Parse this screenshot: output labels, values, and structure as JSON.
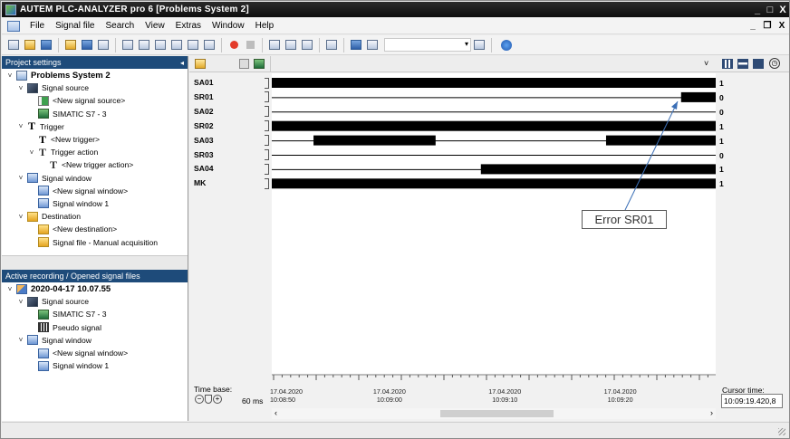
{
  "window": {
    "title": "AUTEM  PLC-ANALYZER pro 6 [Problems System 2]",
    "min": "_",
    "max": "□",
    "close": "X"
  },
  "menu": {
    "items": [
      "File",
      "Signal file",
      "Search",
      "View",
      "Extras",
      "Window",
      "Help"
    ],
    "mdi_min": "_",
    "mdi_restore": "❐",
    "mdi_close": "X"
  },
  "project_panel": {
    "title": "Project settings",
    "tree": [
      {
        "level": 0,
        "toggle": "˅",
        "icon": "project-icon",
        "label": "Problems System 2",
        "bold": true
      },
      {
        "level": 1,
        "toggle": "˅",
        "icon": "signal-source-icon",
        "label": "Signal source"
      },
      {
        "level": 2,
        "toggle": "",
        "icon": "new-source-icon",
        "label": "<New signal source>"
      },
      {
        "level": 2,
        "toggle": "",
        "icon": "plc-icon",
        "label": "SIMATIC S7 - 3"
      },
      {
        "level": 1,
        "toggle": "˅",
        "icon": "trigger-icon",
        "label": "Trigger"
      },
      {
        "level": 2,
        "toggle": "",
        "icon": "trigger-icon",
        "label": "<New trigger>"
      },
      {
        "level": 2,
        "toggle": "˅",
        "icon": "trigger-action-icon",
        "label": "Trigger action"
      },
      {
        "level": 3,
        "toggle": "",
        "icon": "trigger-action-icon",
        "label": "<New trigger action>"
      },
      {
        "level": 1,
        "toggle": "˅",
        "icon": "signal-window-icon",
        "label": "Signal window"
      },
      {
        "level": 2,
        "toggle": "",
        "icon": "signal-window-icon",
        "label": "<New signal window>"
      },
      {
        "level": 2,
        "toggle": "",
        "icon": "signal-window-icon",
        "label": "Signal window 1"
      },
      {
        "level": 1,
        "toggle": "˅",
        "icon": "destination-icon",
        "label": "Destination"
      },
      {
        "level": 2,
        "toggle": "",
        "icon": "destination-icon",
        "label": "<New destination>"
      },
      {
        "level": 2,
        "toggle": "",
        "icon": "destination-icon",
        "label": "Signal file - Manual acquisition"
      }
    ]
  },
  "recording_panel": {
    "title": "Active recording / Opened signal files",
    "tree": [
      {
        "level": 0,
        "toggle": "˅",
        "icon": "recording-icon",
        "label": "2020-04-17 10.07.55",
        "bold": true
      },
      {
        "level": 1,
        "toggle": "˅",
        "icon": "signal-source-icon",
        "label": "Signal source"
      },
      {
        "level": 2,
        "toggle": "",
        "icon": "plc-icon",
        "label": "SIMATIC S7 - 3"
      },
      {
        "level": 2,
        "toggle": "",
        "icon": "pseudo-signal-icon",
        "label": "Pseudo signal"
      },
      {
        "level": 1,
        "toggle": "˅",
        "icon": "signal-window-icon",
        "label": "Signal window"
      },
      {
        "level": 2,
        "toggle": "",
        "icon": "signal-window-icon",
        "label": "<New signal window>"
      },
      {
        "level": 2,
        "toggle": "",
        "icon": "signal-window-icon",
        "label": "Signal window 1"
      }
    ]
  },
  "signals": [
    {
      "name": "SA01",
      "value": "1",
      "high": [
        [
          0,
          100
        ]
      ]
    },
    {
      "name": "SR01",
      "value": "0",
      "high": [
        [
          92.2,
          100
        ]
      ]
    },
    {
      "name": "SA02",
      "value": "0",
      "high": []
    },
    {
      "name": "SR02",
      "value": "1",
      "high": [
        [
          0,
          100
        ]
      ]
    },
    {
      "name": "SA03",
      "value": "1",
      "high": [
        [
          9.4,
          36.9
        ],
        [
          75.3,
          100
        ]
      ]
    },
    {
      "name": "SR03",
      "value": "0",
      "high": []
    },
    {
      "name": "SA04",
      "value": "1",
      "high": [
        [
          47.1,
          100
        ]
      ]
    },
    {
      "name": "MK",
      "value": "1",
      "high": [
        [
          0,
          100
        ]
      ]
    }
  ],
  "timebase": {
    "label": "Time base:",
    "value": "60 ms"
  },
  "time_axis": [
    {
      "date": "17.04.2020",
      "time": "10:08:50",
      "pos": 0
    },
    {
      "date": "17.04.2020",
      "time": "10:09:00",
      "pos": 26.5
    },
    {
      "date": "17.04.2020",
      "time": "10:09:10",
      "pos": 52.5
    },
    {
      "date": "17.04.2020",
      "time": "10:09:20",
      "pos": 78.5
    }
  ],
  "cursor": {
    "label": "Cursor time:",
    "value": "10:09:19.420,8"
  },
  "annotation": {
    "text": "Error SR01"
  },
  "colors": {
    "signal_high": "#000000",
    "panel_header": "#1e4b7a",
    "annotation_line": "#3b6fb6"
  }
}
